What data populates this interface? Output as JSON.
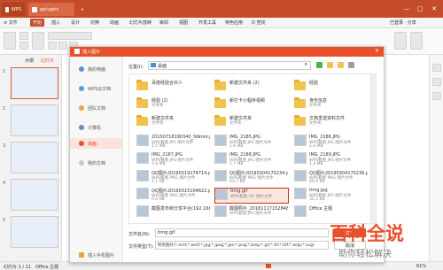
{
  "titlebar": {
    "app_tab": "WPS",
    "doc_tab": "ppt.pptx",
    "add_tab": "+",
    "min": "—",
    "max": "▢",
    "close": "✕"
  },
  "menubar": {
    "items": [
      "≡ 文件",
      "开始",
      "插入",
      "设计",
      "切换",
      "动画",
      "幻灯片放映",
      "审阅",
      "视图",
      "开发工具",
      "特色应用",
      "Q 查找"
    ],
    "right": "已登录 · 分享"
  },
  "slidepanel": {
    "tabs": [
      "大纲",
      "幻灯片"
    ],
    "slides": [
      "1",
      "2",
      "3",
      "4",
      "5"
    ]
  },
  "status": {
    "left": "幻灯片 1 / 11",
    "theme": "Office 主题",
    "zoom": "61%"
  },
  "dialog": {
    "title": "插入图片",
    "location_label": "位置(I):",
    "location_value": "桌面",
    "sidebar": [
      {
        "label": "我的电脑",
        "icon": "computer-icon",
        "active": false
      },
      {
        "label": "WPS云文档",
        "icon": "cloud-icon",
        "active": false
      },
      {
        "label": "团队文档",
        "icon": "team-icon",
        "active": false
      },
      {
        "label": "计算机",
        "icon": "pc-icon",
        "active": false
      },
      {
        "label": "桌面",
        "icon": "desktop-icon",
        "active": true
      },
      {
        "label": "我的文档",
        "icon": "docs-icon",
        "active": false
      }
    ],
    "phone_label": "插入手机图片",
    "folders_col1": [
      {
        "name": "百度经验合伙人",
        "sub": ""
      },
      {
        "name": "经验 (2)",
        "sub": "文件夹"
      },
      {
        "name": "新建文件夹",
        "sub": "文件夹"
      }
    ],
    "folders_col2": [
      {
        "name": "新建文件夹 (2)",
        "sub": ""
      },
      {
        "name": "新打卡小程序视频",
        "sub": ""
      },
      {
        "name": "新建文件夹",
        "sub": "文件夹"
      }
    ],
    "folders_col3": [
      {
        "name": "经验",
        "sub": ""
      },
      {
        "name": "身份信息",
        "sub": "文件夹"
      },
      {
        "name": "文档发送资料文件",
        "sub": "文件夹"
      }
    ],
    "files": [
      {
        "name": "20150718190340_SNmm.jpg",
        "sub": "WPS看图 JPG 图片文件",
        "size": "1.5 MB",
        "col": 0,
        "row": 0
      },
      {
        "name": "IMG_2185.JPG",
        "sub": "WPS看图 JPG 图片文件",
        "size": "1.6 MB",
        "col": 1,
        "row": 0
      },
      {
        "name": "IMG_2186.JPG",
        "sub": "WPS看图 JPG 图片文件",
        "size": "1.4 MB",
        "col": 2,
        "row": 0
      },
      {
        "name": "IMG_2187.JPG",
        "sub": "WPS看图 JPG 图片文件",
        "size": "1.6 MB",
        "col": 0,
        "row": 1
      },
      {
        "name": "IMG_2188.JPG",
        "sub": "WPS看图 JPG 图片文件",
        "size": "1.7 MB",
        "col": 1,
        "row": 1
      },
      {
        "name": "IMG_2189.JPG",
        "sub": "WPS看图 JPG 图片文件",
        "size": "1.4 MB",
        "col": 2,
        "row": 1
      },
      {
        "name": "QQ图片20190319174714.png",
        "sub": "WPS看图 PNG 图片文件",
        "size": "1.1 KB",
        "col": 0,
        "row": 2
      },
      {
        "name": "QQ图片20190304170234.png",
        "sub": "WPS看图 PNG 图片文件",
        "size": "63.7 KB",
        "col": 1,
        "row": 2
      },
      {
        "name": "QQ图片20190304170236.png",
        "sub": "WPS看图 PNG 图片文件",
        "size": "49.6 KB",
        "col": 2,
        "row": 2
      },
      {
        "name": "QQ图片20190315104622.png",
        "sub": "WPS看图 PNG 图片文件",
        "size": "6.0 KB",
        "col": 0,
        "row": 3
      },
      {
        "name": "timg.gif",
        "sub": "WPS看图 GIF 图片文件",
        "size": "",
        "col": 1,
        "row": 3,
        "selected": true
      },
      {
        "name": "timg.jpg",
        "sub": "WPS看图 JPG 图片文件",
        "size": "32.3 KB",
        "col": 2,
        "row": 3
      },
      {
        "name": "截图发布到分享平台(192.168.10.177) - 快捷方式",
        "sub": "",
        "size": "",
        "col": 0,
        "row": 4
      },
      {
        "name": "截图照片_20181117152848.jpg",
        "sub": "WPS看图 JPG 图片文件",
        "size": "",
        "col": 1,
        "row": 4
      },
      {
        "name": "Office 主题",
        "sub": "",
        "size": "",
        "col": 2,
        "row": 4
      }
    ],
    "filename_label": "文件名(N):",
    "filename_value": "timg.gif",
    "filetype_label": "文件类型(T):",
    "filetype_value": "所有图片(*.emf;*.wmf;*.jpg;*.jpeg;*.jpe;*.png;*.bmp;*.gif;*.tif;*.tiff;*.wdp;*.svg)",
    "open_button": "打开",
    "cancel_button": "取消"
  },
  "watermark": {
    "main": "百科全说",
    "sub": "助你轻松解决"
  }
}
